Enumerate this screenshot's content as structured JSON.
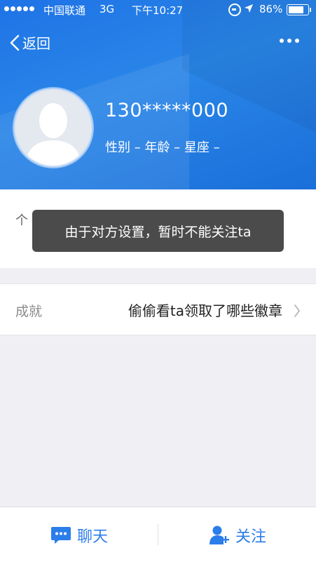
{
  "status_bar": {
    "carrier": "中国联通",
    "network": "3G",
    "time": "下午10:27",
    "battery_percent": "86%",
    "battery_level": 0.86
  },
  "nav": {
    "back_label": "返回",
    "more_icon": "more-dots-icon"
  },
  "profile": {
    "name": "130*****000",
    "meta": "性别 – 年龄 – 星座 –"
  },
  "info": {
    "signature_label_partial": "个"
  },
  "toast": {
    "message": "由于对方设置，暂时不能关注ta"
  },
  "achievements": {
    "label": "成就",
    "value": "偷偷看ta领取了哪些徽章"
  },
  "bottom_bar": {
    "chat_label": "聊天",
    "follow_label": "关注"
  },
  "colors": {
    "header_blue": "#1e73e6",
    "accent": "#2b7de9"
  }
}
